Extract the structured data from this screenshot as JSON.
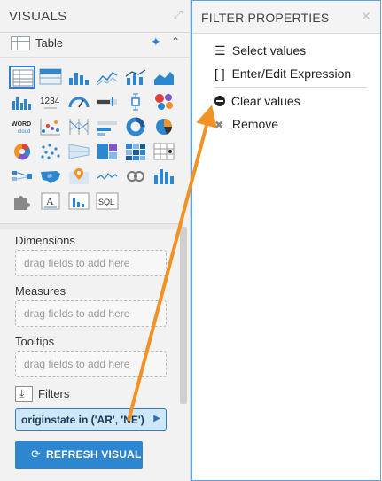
{
  "visuals_panel": {
    "title": "VISUALS",
    "selected_type": "Table",
    "sections": {
      "dimensions": {
        "label": "Dimensions",
        "placeholder": "drag fields to add here"
      },
      "measures": {
        "label": "Measures",
        "placeholder": "drag fields to add here"
      },
      "tooltips": {
        "label": "Tooltips",
        "placeholder": "drag fields to add here"
      },
      "filters": {
        "label": "Filters",
        "chip": "originstate in ('AR', 'NE')"
      }
    },
    "refresh_button": "REFRESH VISUAL",
    "visual_type_icons": [
      "table-icon",
      "cross-tab-icon",
      "bar-chart-icon",
      "line-chart-icon",
      "combo-bar-line-icon",
      "area-chart-icon",
      "grouped-bars-icon",
      "kpi-icon",
      "gauge-icon",
      "bullet-icon",
      "box-plot-icon",
      "packed-bubbles-icon",
      "word-cloud-icon",
      "scatter-icon",
      "parallel-coordinates-icon",
      "histogram-icon",
      "donut-icon",
      "pie-icon",
      "radial-icon",
      "network-icon",
      "funnel-icon",
      "treemap-icon",
      "heatmap-icon",
      "calendar-heatmap-icon",
      "flow-icon",
      "us-map-icon",
      "interactive-map-icon",
      "sparklines-icon",
      "chord-icon",
      "trellis-bars-icon",
      "extension-icon",
      "rich-text-icon",
      "field-statistics-icon",
      "sql-icon"
    ],
    "kpi_icon_text": "1234",
    "rich_text_icon_text": "A",
    "sql_icon_text": "SQL"
  },
  "filter_properties": {
    "title": "FILTER PROPERTIES",
    "items": [
      {
        "label": "Select values",
        "icon": "list-icon",
        "glyph": "☰"
      },
      {
        "label": "Enter/Edit Expression",
        "icon": "brackets-icon",
        "glyph": "[ ]"
      },
      {
        "label": "Clear values",
        "icon": "minus-circle-icon",
        "glyph": ""
      },
      {
        "label": "Remove",
        "icon": "close-x-icon",
        "glyph": "✖"
      }
    ]
  },
  "colors": {
    "accent_blue": "#2d86d0",
    "chip_fill": "#cfe7fa",
    "annotation_arrow": "#f39224",
    "panel_border": "#5fa0d8"
  }
}
